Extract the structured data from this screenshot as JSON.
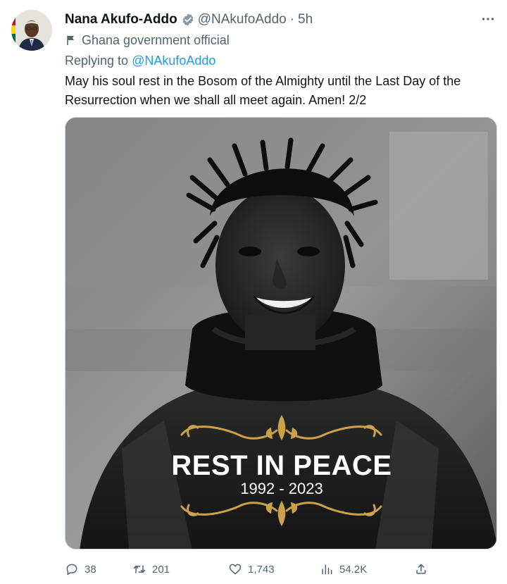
{
  "author": {
    "name": "Nana Akufo-Addo",
    "handle": "@NAkufoAddo",
    "separator": "·",
    "time": "5h",
    "affiliation": "Ghana government official",
    "avatar_icon": "profile-photo",
    "verified_color": "#829aab"
  },
  "reply": {
    "prefix": "Replying to",
    "mention": "@NAkufoAddo"
  },
  "tweet_text": "May his soul rest in the Bosom of the Almighty until the Last Day of the Resurrection when we shall all meet again. Amen! 2/2",
  "media": {
    "headline": "REST IN PEACE",
    "years": "1992 - 2023",
    "ornament_color": "#c9a24a"
  },
  "actions": {
    "replies": "38",
    "retweets": "201",
    "likes": "1,743",
    "views": "54.2K"
  },
  "colors": {
    "text": "#0f1419",
    "secondary": "#536471",
    "link": "#1d9bf0"
  }
}
